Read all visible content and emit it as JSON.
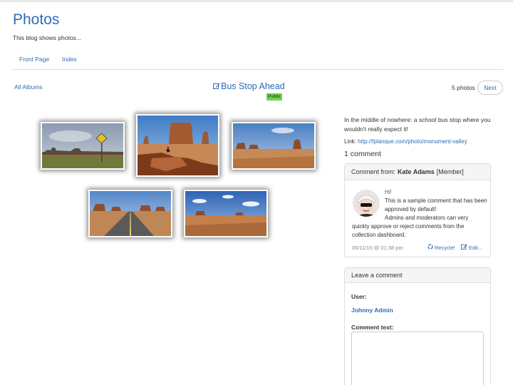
{
  "site": {
    "title": "Photos",
    "tagline": "This blog shows photos..."
  },
  "nav": {
    "items": [
      {
        "label": "Front Page"
      },
      {
        "label": "Index"
      }
    ]
  },
  "album": {
    "back_label": "All Albums",
    "title": "Bus Stop Ahead",
    "status_badge": "Public",
    "photo_count": "5 photos",
    "next_label": "Next"
  },
  "photos": [
    {
      "subject": "desert road with bus stop sign"
    },
    {
      "subject": "rider on cliff overlooking mesa"
    },
    {
      "subject": "monument valley buttes"
    },
    {
      "subject": "long straight road to buttes"
    },
    {
      "subject": "desert plain with clouds"
    }
  ],
  "description": {
    "text": "In the middle of nowhere: a school bus stop where you wouldn't really expect it!",
    "link_prefix": "Link:",
    "link_url": "http://fplanque.com/photo/monument-valley"
  },
  "comments": {
    "count_label": "1 comment",
    "items": [
      {
        "header_prefix": "Comment from:",
        "author": "Kate Adams",
        "role": "[Member]",
        "lines": [
          "Hi!",
          "This is a sample comment that has been approved by default!",
          "Admins and moderators can very quickly approve or reject comments from the collection dashboard."
        ],
        "date": "05/11/15 @ 01:38 pm",
        "recycle_label": "Recycle!",
        "edit_label": "Edit..."
      }
    ]
  },
  "leave_comment": {
    "title": "Leave a comment",
    "user_label": "User:",
    "user_name": "Johnny Admin",
    "text_label": "Comment text:",
    "text_value": ""
  },
  "colors": {
    "link": "#2a6db5",
    "badge": "#6fd34c"
  }
}
